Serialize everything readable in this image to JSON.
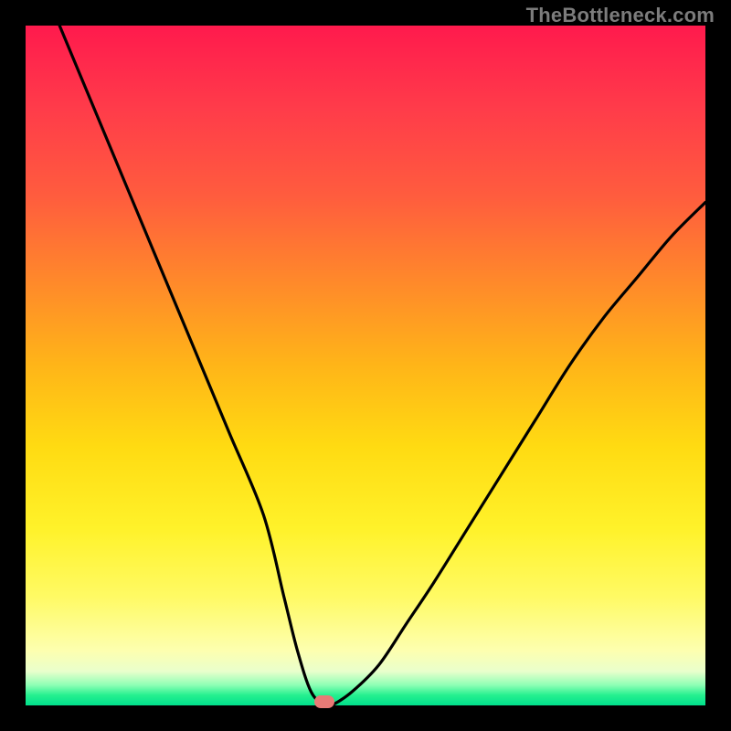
{
  "watermark": "TheBottleneck.com",
  "chart_data": {
    "type": "line",
    "title": "",
    "xlabel": "",
    "ylabel": "",
    "xlim": [
      0,
      100
    ],
    "ylim": [
      0,
      100
    ],
    "series": [
      {
        "name": "bottleneck-curve",
        "x": [
          5,
          10,
          15,
          20,
          25,
          30,
          35,
          38,
          40,
          42,
          44,
          45,
          48,
          52,
          56,
          60,
          65,
          70,
          75,
          80,
          85,
          90,
          95,
          100
        ],
        "values": [
          100,
          88,
          76,
          64,
          52,
          40,
          28,
          16,
          8,
          2,
          0,
          0,
          2,
          6,
          12,
          18,
          26,
          34,
          42,
          50,
          57,
          63,
          69,
          74
        ]
      }
    ],
    "marker": {
      "x": 44,
      "y": 0
    },
    "gradient_stops": [
      {
        "pos": 0,
        "color": "#ff1a4d"
      },
      {
        "pos": 0.5,
        "color": "#ffdb12"
      },
      {
        "pos": 0.95,
        "color": "#e9ffcc"
      },
      {
        "pos": 1.0,
        "color": "#00e08c"
      }
    ]
  }
}
